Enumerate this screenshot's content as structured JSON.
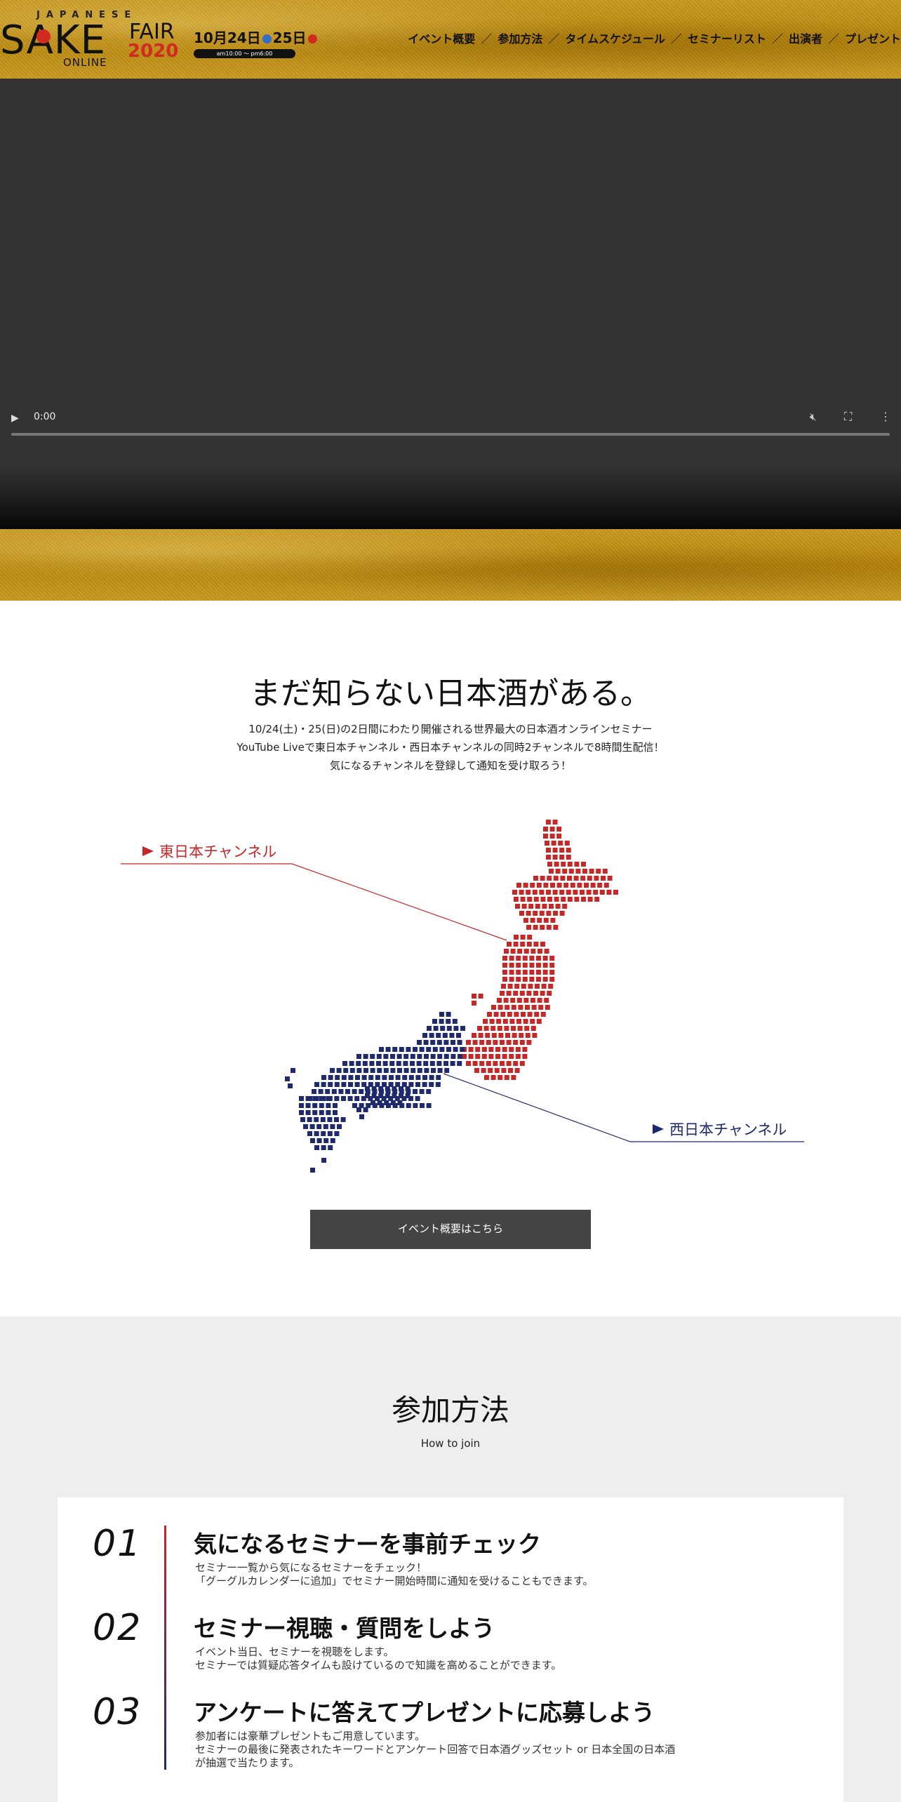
{
  "header": {
    "logo": {
      "japanese": "JAPANESE",
      "sake": "SAKE",
      "fair": "FAIR",
      "year": "2020",
      "online": "ONLINE"
    },
    "date": {
      "day1": "10月24日",
      "day1_dow": "土",
      "day2": "25日",
      "day2_dow": "日",
      "time": "am10:00 〜 pm6:00"
    },
    "nav": [
      "イベント概要",
      "参加方法",
      "タイムスケジュール",
      "セミナーリスト",
      "出演者",
      "プレゼント"
    ],
    "nav_separator": "／"
  },
  "video": {
    "time": "0:00",
    "play_icon": "play-icon",
    "mute_icon": "mute-icon",
    "fullscreen_icon": "fullscreen-icon",
    "more_icon": "more-icon"
  },
  "intro": {
    "title": "まだ知らない日本酒がある。",
    "lines": [
      "10/24(土)・25(日)の2日間にわたり開催される世界最大の日本酒オンラインセミナー",
      "YouTube Liveで東日本チャンネル・西日本チャンネルの同時2チャンネルで8時間生配信！",
      "気になるチャンネルを登録して通知を受け取ろう！"
    ]
  },
  "map": {
    "east_label": "東日本チャンネル",
    "west_label": "西日本チャンネル",
    "east_color": "#c62828",
    "west_color": "#1f2a6d"
  },
  "overview_button": "イベント概要はこちら",
  "join": {
    "title": "参加方法",
    "subtitle": "How to join",
    "steps": [
      {
        "num": "01",
        "title": "気になるセミナーを事前チェック",
        "lines": [
          "セミナー一覧から気になるセミナーをチェック！",
          "「グーグルカレンダーに追加」でセミナー開始時間に通知を受けることもできます。"
        ]
      },
      {
        "num": "02",
        "title": "セミナー視聴・質問をしよう",
        "lines": [
          "イベント当日、セミナーを視聴をします。",
          "セミナーでは質疑応答タイムも設けているので知識を高めることができます。"
        ]
      },
      {
        "num": "03",
        "title": "アンケートに答えてプレゼントに応募しよう",
        "lines": [
          "参加者には豪華プレゼントもご用意しています。",
          "セミナーの最後に発表されたキーワードとアンケート回答で日本酒グッズセット or 日本全国の日本酒",
          "が抽選で当たります。"
        ]
      }
    ]
  }
}
